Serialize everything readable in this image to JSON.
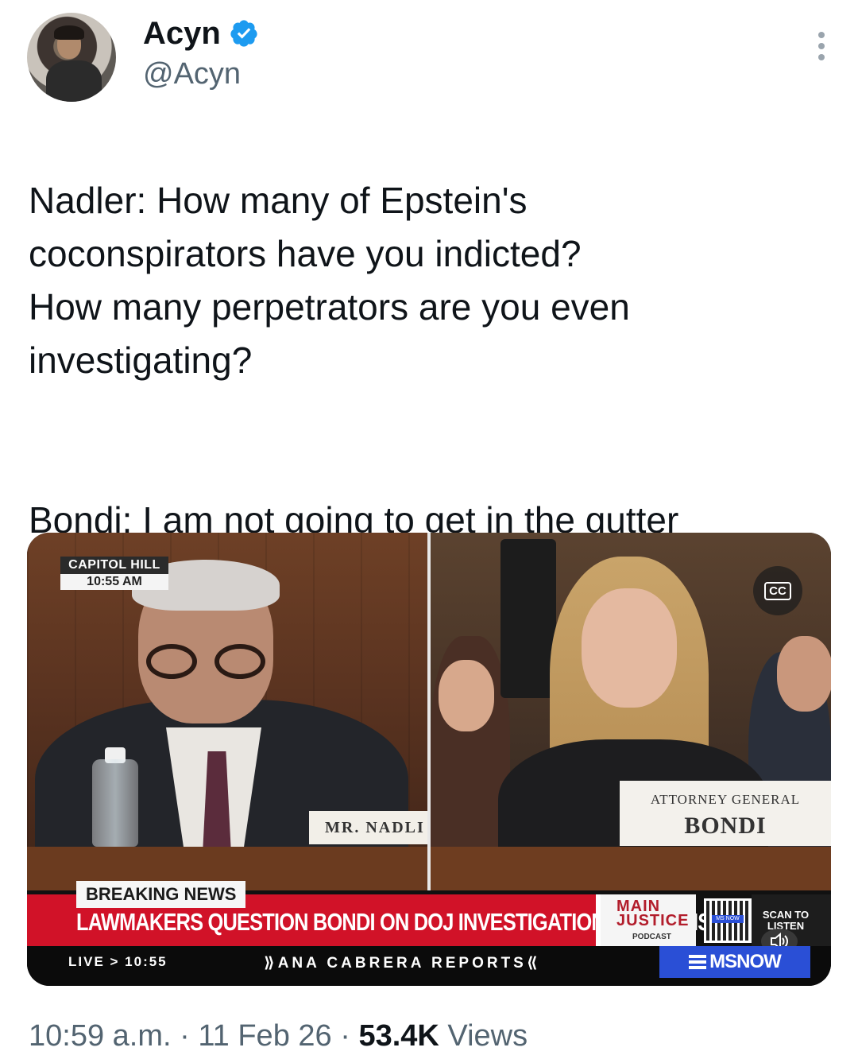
{
  "author": {
    "display_name": "Acyn",
    "handle": "@Acyn",
    "verified": true
  },
  "tweet": {
    "paragraphs": [
      "Nadler: How many of Epstein's\ncoconspirators have you indicted?\nHow many perpetrators are you even\ninvestigating?",
      "Bondi: I am not going to get in the gutter\nwith these people."
    ]
  },
  "media": {
    "location_tag": "CAPITOL HILL",
    "location_time": "10:55 AM",
    "left_nameplate": "MR. NADLI",
    "right_nameplate_title": "ATTORNEY GENERAL",
    "right_nameplate_name": "BONDI",
    "cc_label": "CC",
    "breaking_label": "BREAKING NEWS",
    "headline": "LAWMAKERS QUESTION BONDI ON DOJ INVESTIGATIONS OF DEMS",
    "promo_title_line1": "MAIN",
    "promo_title_line2": "JUSTICE",
    "promo_subtitle": "PODCAST",
    "qr_badge": "MS NOW",
    "scan_text": "SCAN TO LISTEN",
    "live_label": "LIVE > 10:55",
    "show_name": "⟫ANA CABRERA REPORTS⟪",
    "network": "MSNOW"
  },
  "meta": {
    "time": "10:59 a.m.",
    "sep1": "·",
    "date": "11 Feb 26",
    "sep2": "·",
    "views_count": "53.4K",
    "views_label": "Views"
  },
  "colors": {
    "verified_blue": "#1d9bf0",
    "breaking_red": "#d11228",
    "network_blue": "#2a4fd6",
    "secondary_text": "#536471"
  },
  "icons": {
    "verified": "verified-badge-icon",
    "more": "more-dots-icon",
    "cc": "closed-captions-icon",
    "speaker": "speaker-icon"
  }
}
